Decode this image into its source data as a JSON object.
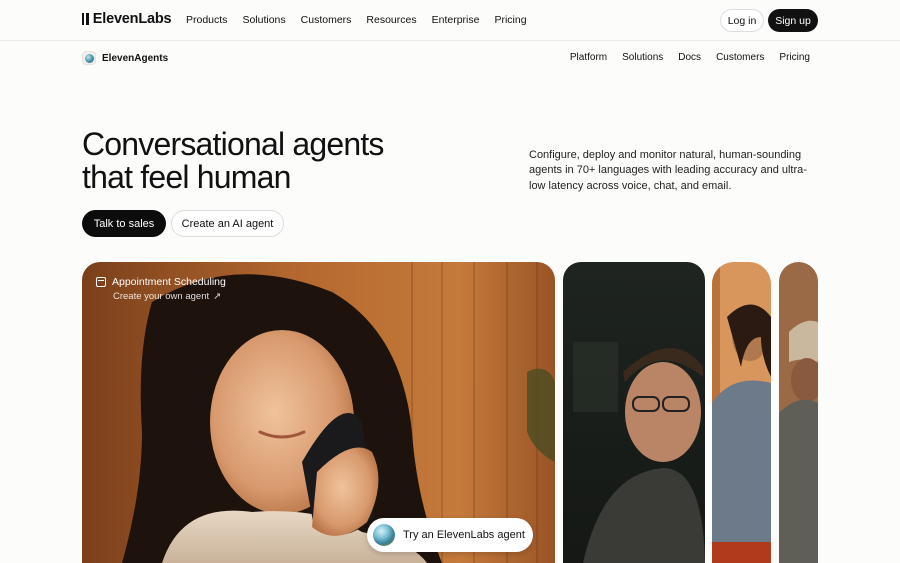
{
  "brand": {
    "name": "ElevenLabs"
  },
  "nav": {
    "menu": [
      "Products",
      "Solutions",
      "Customers",
      "Resources",
      "Enterprise",
      "Pricing"
    ],
    "login": "Log in",
    "signup": "Sign up"
  },
  "subnav": {
    "product": "ElevenAgents",
    "menu": [
      "Platform",
      "Solutions",
      "Docs",
      "Customers",
      "Pricing"
    ]
  },
  "hero": {
    "headline_line1": "Conversational agents",
    "headline_line2": "that feel human",
    "description": "Configure, deploy and monitor natural, human-sounding agents in 70+ languages with leading accuracy and ultra-low latency across voice, chat, and email.",
    "cta_primary": "Talk to sales",
    "cta_secondary": "Create an AI agent"
  },
  "feature_card": {
    "title": "Appointment Scheduling",
    "link": "Create your own agent",
    "link_icon": "arrow-up-right-icon",
    "label_icon": "calendar-icon"
  },
  "try_button": {
    "label": "Try an ElevenLabs agent",
    "icon": "orb-icon"
  },
  "colors": {
    "accent": "#111111",
    "background": "#fcfcfb",
    "card_warm": "#b8662e"
  }
}
